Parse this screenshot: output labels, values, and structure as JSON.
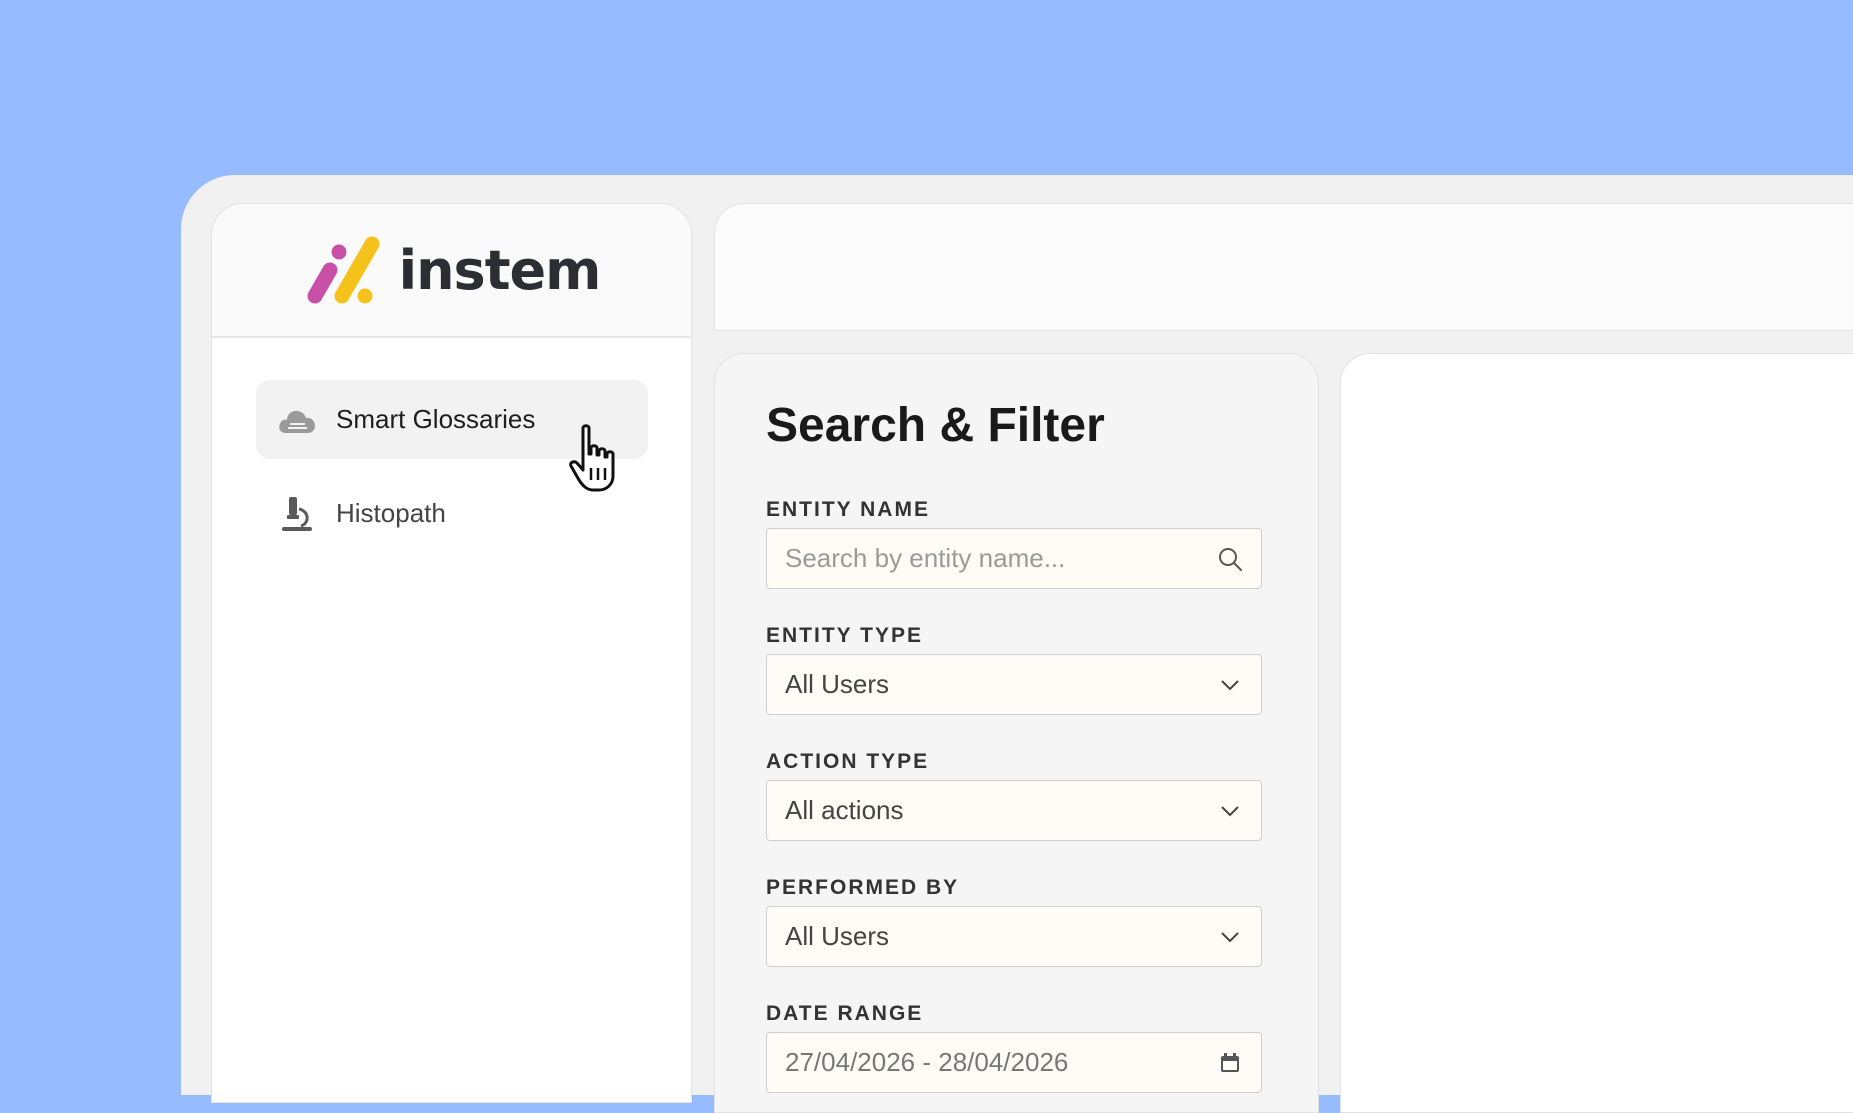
{
  "brand": {
    "name": "instem",
    "colors": {
      "pink": "#c850a8",
      "yellow": "#f5c21b",
      "text": "#2d2d34"
    }
  },
  "sidebar": {
    "items": [
      {
        "label": "Smart Glossaries",
        "icon": "cloud-icon",
        "active": true
      },
      {
        "label": "Histopath",
        "icon": "microscope-icon",
        "active": false
      }
    ]
  },
  "filter": {
    "title": "Search & Filter",
    "entity_name": {
      "label": "ENTITY NAME",
      "placeholder": "Search by entity name..."
    },
    "entity_type": {
      "label": "ENTITY TYPE",
      "value": "All Users"
    },
    "action_type": {
      "label": "ACTION TYPE",
      "value": "All actions"
    },
    "performed_by": {
      "label": "PERFORMED BY",
      "value": "All Users"
    },
    "date_range": {
      "label": "DATE RANGE",
      "value": "27/04/2026 - 28/04/2026"
    }
  },
  "colors": {
    "background": "#96bbff",
    "frame": "#f1f1f1",
    "card": "#f5f5f5",
    "input": "#fffcf8"
  }
}
